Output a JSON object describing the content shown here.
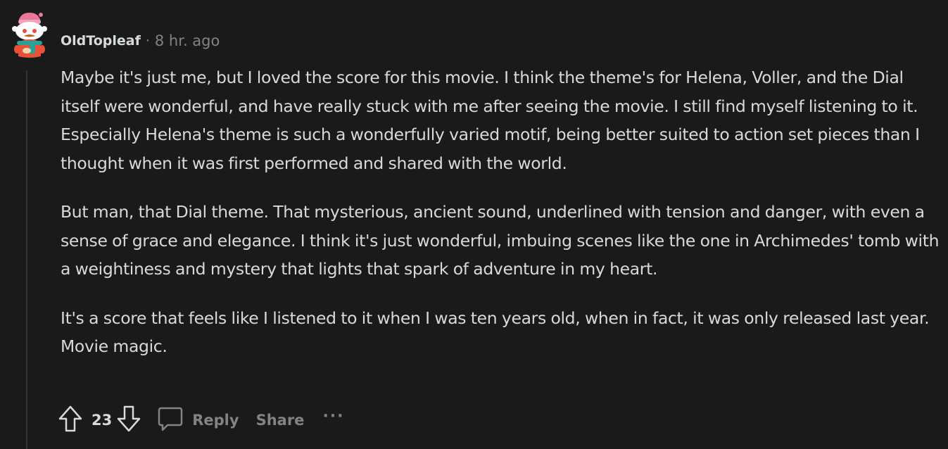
{
  "comment": {
    "username": "OldTopleaf",
    "separator": "·",
    "timestamp": "8 hr. ago",
    "paragraphs": [
      "Maybe it's just me, but I loved the score for this movie. I think the theme's for Helena, Voller, and the Dial itself were wonderful, and have really stuck with me after seeing the movie. I still find myself listening to it. Especially Helena's theme is such a wonderfully varied motif, being better suited to action set pieces than I thought when it was first performed and shared with the world.",
      "But man, that Dial theme. That mysterious, ancient sound, underlined with tension and danger, with even a sense of grace and elegance. I think it's just wonderful, imbuing scenes like the one in Archimedes' tomb with a weightiness and mystery that lights that spark of adventure in my heart.",
      "It's a score that feels like I listened to it when I was ten years old, when in fact, it was only released last year. Movie magic."
    ],
    "score": "23"
  },
  "actions": {
    "upvote_icon": "arrow-up-icon",
    "downvote_icon": "arrow-down-icon",
    "reply_icon": "speech-bubble-icon",
    "reply_label": "Reply",
    "share_label": "Share",
    "more_label": "···"
  },
  "colors": {
    "background": "#1a1a1b",
    "text": "#d7dadc",
    "muted": "#818384",
    "thread_line": "#343536",
    "avatar_red": "#e8503a",
    "avatar_pink": "#e9789b",
    "avatar_teal": "#2aa198"
  }
}
